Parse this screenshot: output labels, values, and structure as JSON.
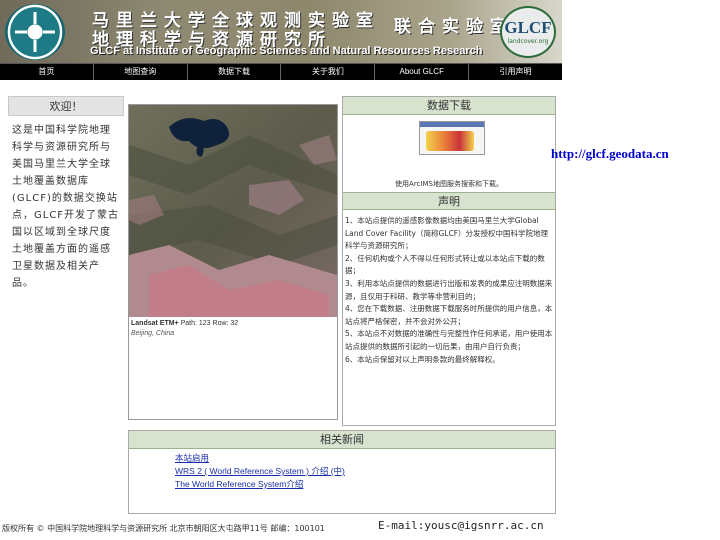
{
  "header": {
    "title_cn_line1": "马里兰大学全球观测实验室",
    "title_cn_join": "联合实验室",
    "title_cn_line2": "地理科学与资源研究所",
    "title_en": "GLCF at Institute of Geographic Sciences and Natural Resources Research",
    "logo_right": "GLCF",
    "logo_right_sub": "landcover.org"
  },
  "nav": [
    "首页",
    "地图查询",
    "数据下载",
    "关于我们",
    "About GLCF",
    "引用声明"
  ],
  "welcome": {
    "title": "欢迎！",
    "text": "这是中国科学院地理科学与资源研究所与美国马里兰大学全球土地覆盖数据库(GLCF)的数据交换站点，GLCF开发了蒙古国以区域到全球尺度土地覆盖方面的遥感卫星数据及相关产品。"
  },
  "satellite": {
    "caption_title": "Landsat ETM+",
    "caption_path": "Path: 123  Row: 32",
    "caption_place": "Beijing, China"
  },
  "right_panel": {
    "download_title": "数据下载",
    "download_note": "使用ArcIMS地图服务搜索和下载。",
    "statement_title": "声明",
    "statement_items": [
      "1、本站点提供的遥感影像数据均由美国马里兰大学Global Land Cover Facility（简称GLCF）分发授权中国科学院地理科学与资源研究所；",
      "2、任何机构或个人不得以任何形式转让或以本站点下载的数据；",
      "3、利用本站点提供的数据进行出版和发表的成果应注明数据来源，且仅用于科研、教学等非营利目的；",
      "4、您在下载数据、注册数据下载服务时所提供的用户信息，本站点将严格保密，并不会对外公开；",
      "5、本站点不对数据的准确性与完整性作任何承诺，用户使用本站点提供的数据所引起的一切后果，由用户自行负责；",
      "6、本站点保留对以上声明条款的最终解释权。"
    ]
  },
  "news": {
    "title": "相关新闻",
    "items": [
      "本站启用",
      "WRS 2 ( World Reference System ) 介绍 (中)",
      "The World Reference System介绍"
    ]
  },
  "footer": {
    "address": "版权所有 © 中国科学院地理科学与资源研究所 北京市朝阳区大屯路甲11号  邮编：100101",
    "email": "E-mail:yousc@igsnrr.ac.cn"
  },
  "url_overlay": "http://glcf.geodata.cn"
}
